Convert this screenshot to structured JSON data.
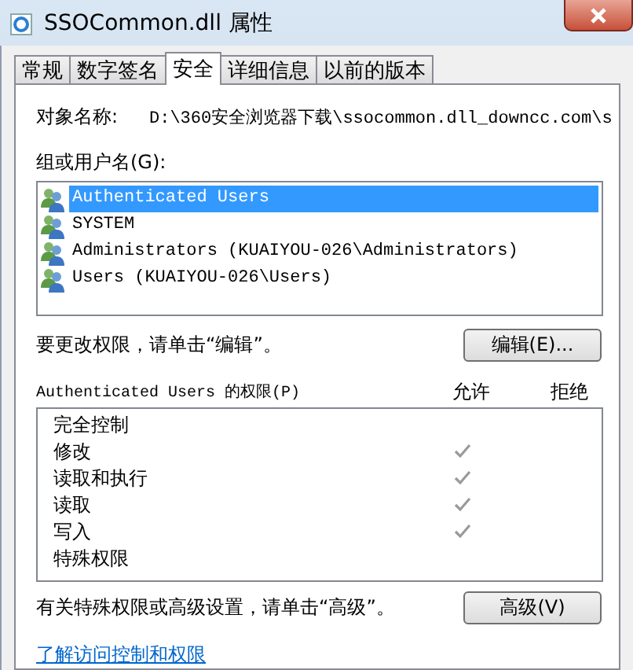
{
  "window": {
    "title": "SSOCommon.dll 属性"
  },
  "tabs": [
    {
      "label": "常规",
      "selected": false
    },
    {
      "label": "数字签名",
      "selected": false
    },
    {
      "label": "安全",
      "selected": true
    },
    {
      "label": "详细信息",
      "selected": false
    },
    {
      "label": "以前的版本",
      "selected": false
    }
  ],
  "object_name": {
    "label": "对象名称:",
    "value": "D:\\360安全浏览器下载\\ssocommon.dll_downcc.com\\s"
  },
  "groups": {
    "label": "组或用户名(G):",
    "items": [
      {
        "name": "Authenticated Users",
        "selected": true
      },
      {
        "name": "SYSTEM",
        "selected": false
      },
      {
        "name": "Administrators (KUAIYOU-026\\Administrators)",
        "selected": false
      },
      {
        "name": "Users (KUAIYOU-026\\Users)",
        "selected": false
      }
    ]
  },
  "edit_hint": "要更改权限，请单击“编辑”。",
  "edit_button": "编辑(E)...",
  "permissions": {
    "title": "Authenticated Users 的权限(P)",
    "allow_heading": "允许",
    "deny_heading": "拒绝",
    "rows": [
      {
        "name": "完全控制",
        "allow": false,
        "deny": false
      },
      {
        "name": "修改",
        "allow": true,
        "deny": false
      },
      {
        "name": "读取和执行",
        "allow": true,
        "deny": false
      },
      {
        "name": "读取",
        "allow": true,
        "deny": false
      },
      {
        "name": "写入",
        "allow": true,
        "deny": false
      },
      {
        "name": "特殊权限",
        "allow": false,
        "deny": false
      }
    ]
  },
  "advanced_hint": "有关特殊权限或高级设置，请单击“高级”。",
  "advanced_button": "高级(V)",
  "help_link": "了解访问控制和权限"
}
